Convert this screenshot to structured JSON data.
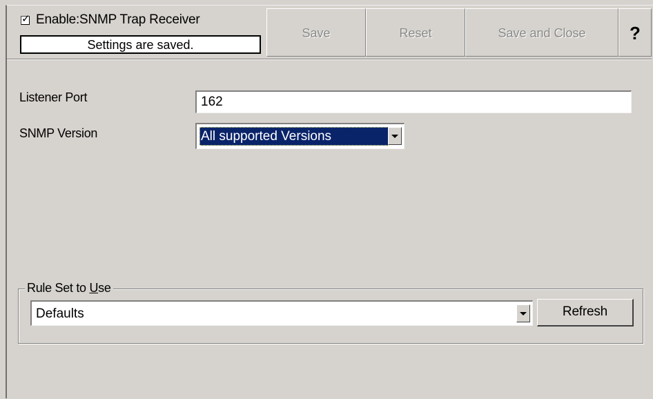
{
  "toolbar": {
    "enable_label": "Enable:SNMP Trap Receiver",
    "enable_checked": true,
    "status_text": "Settings are saved.",
    "save_label": "Save",
    "reset_label": "Reset",
    "save_close_label": "Save and Close",
    "help_label": "?"
  },
  "form": {
    "listener_port_label": "Listener Port",
    "listener_port_value": "162",
    "snmp_version_label": "SNMP Version",
    "snmp_version_value": "All supported Versions"
  },
  "rules": {
    "group_label_pre": "Rule Set to ",
    "group_label_u": "U",
    "group_label_post": "se",
    "selected_value": "Defaults",
    "refresh_label": "Refresh"
  },
  "icons": {
    "checkbox": "check-icon",
    "dropdown": "chevron-down-icon"
  },
  "colors": {
    "background": "#d6d3ce",
    "selection": "#0a246a",
    "disabled_text": "#8a8a8a"
  }
}
